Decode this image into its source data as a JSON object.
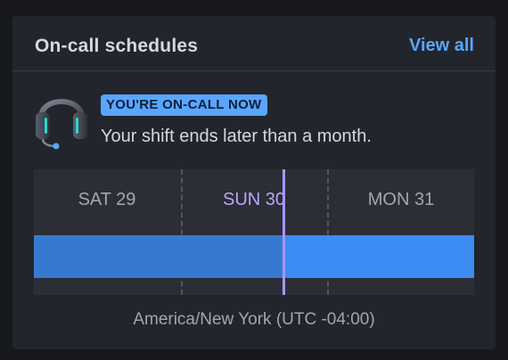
{
  "card": {
    "title": "On-call schedules",
    "view_all_label": "View all"
  },
  "status": {
    "badge": "YOU'RE ON-CALL NOW",
    "shift_text": "Your shift ends later than a month."
  },
  "timeline": {
    "days": [
      "SAT 29",
      "SUN 30",
      "MON 31"
    ],
    "current_day_index": 1
  },
  "timezone": "America/New York (UTC -04:00)",
  "colors": {
    "accent": "#58a6ff",
    "shift_bar": "#3d8bf5",
    "now_marker": "#a894ff"
  },
  "icons": {
    "headset": "headset-icon"
  }
}
